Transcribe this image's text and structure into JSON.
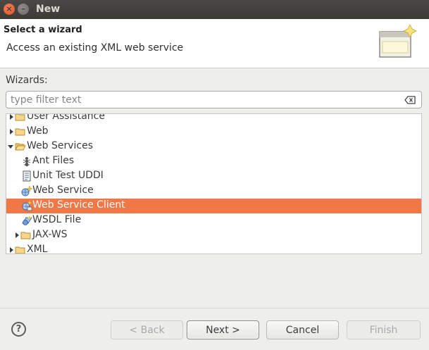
{
  "window": {
    "title": "New",
    "close_glyph": "×",
    "minimize_glyph": "–"
  },
  "header": {
    "title": "Select a wizard",
    "description": "Access an existing XML web service"
  },
  "wizards_label": "Wizards:",
  "filter": {
    "placeholder": "type filter text",
    "value": ""
  },
  "tree": {
    "items": [
      {
        "label": "User Assistance",
        "icon": "folder-icon",
        "expander": "collapsed"
      },
      {
        "label": "Web",
        "icon": "folder-icon",
        "expander": "collapsed"
      },
      {
        "label": "Web Services",
        "icon": "folder-open-icon",
        "expander": "expanded"
      },
      {
        "label": "Ant Files",
        "icon": "ant-icon",
        "expander": "none"
      },
      {
        "label": "Unit Test UDDI",
        "icon": "uddi-test-icon",
        "expander": "none"
      },
      {
        "label": "Web Service",
        "icon": "web-service-icon",
        "expander": "none"
      },
      {
        "label": "Web Service Client",
        "icon": "web-service-client-icon",
        "expander": "none",
        "selected": true
      },
      {
        "label": "WSDL File",
        "icon": "wsdl-file-icon",
        "expander": "none"
      },
      {
        "label": "JAX-WS",
        "icon": "folder-icon",
        "expander": "collapsed"
      },
      {
        "label": "XML",
        "icon": "folder-icon",
        "expander": "collapsed"
      }
    ]
  },
  "buttons": {
    "help": "?",
    "back": "< Back",
    "next": "Next >",
    "cancel": "Cancel",
    "finish": "Finish"
  },
  "colors": {
    "selection": "#f07746",
    "titlebar": "#3c3b37"
  }
}
